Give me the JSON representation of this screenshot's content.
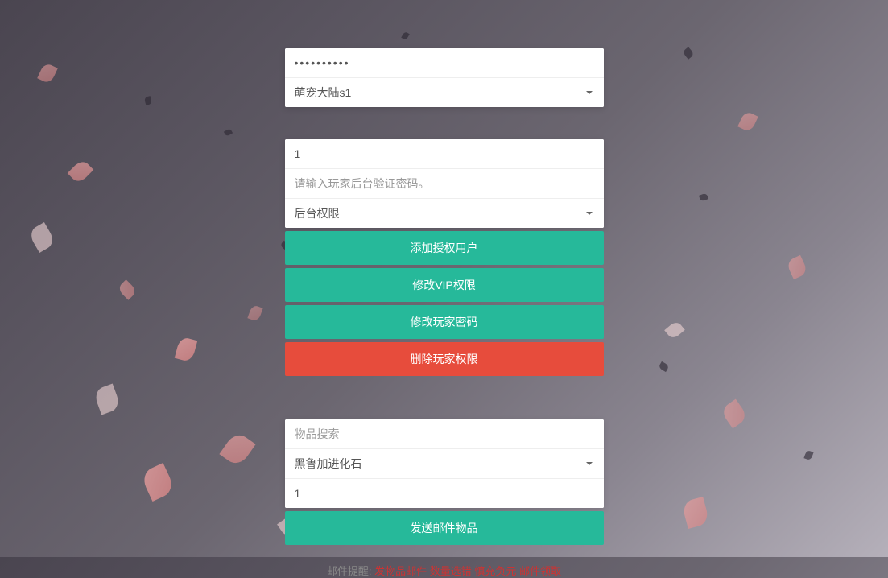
{
  "auth": {
    "password_value": "••••••••••",
    "server_selected": "萌宠大陆s1"
  },
  "player": {
    "id_value": "1",
    "verify_placeholder": "请输入玩家后台验证密码。",
    "permission_selected": "后台权限"
  },
  "actions": {
    "add_user": "添加授权用户",
    "modify_vip": "修改VIP权限",
    "modify_password": "修改玩家密码",
    "delete_permission": "删除玩家权限"
  },
  "mail": {
    "search_placeholder": "物品搜索",
    "item_selected": "黑鲁加进化石",
    "quantity_value": "1",
    "send_button": "发送邮件物品"
  },
  "footer": {
    "prefix": "邮件提醒:",
    "part1": "发物品邮件 数量选错",
    "part2": "慎充负元",
    "part3": "邮件领取"
  }
}
